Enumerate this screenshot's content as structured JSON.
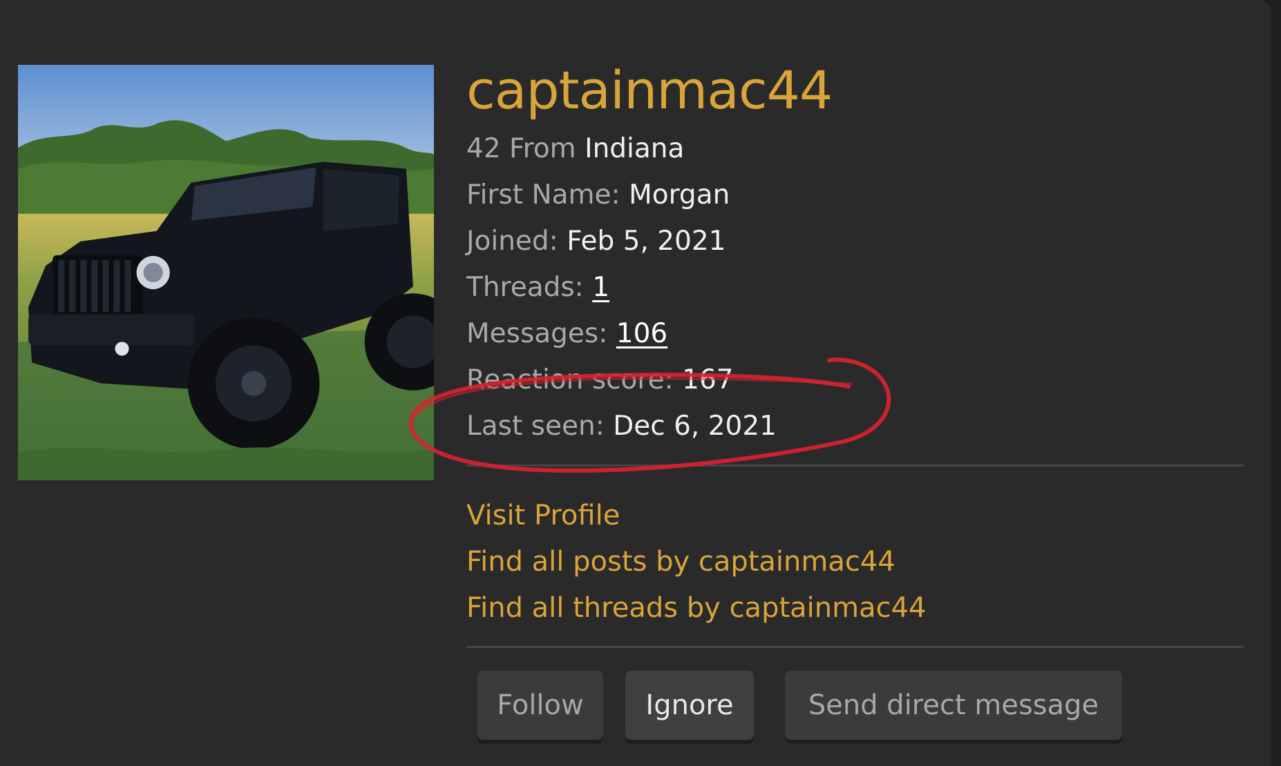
{
  "profile": {
    "username": "captainmac44",
    "age": "42",
    "from_label": "From",
    "location": "Indiana",
    "first_name_label": "First Name:",
    "first_name": "Morgan",
    "joined_label": "Joined:",
    "joined": "Feb 5, 2021",
    "threads_label": "Threads:",
    "threads": "1",
    "messages_label": "Messages:",
    "messages": "106",
    "reaction_label": "Reaction score:",
    "reaction": "167",
    "last_seen_label": "Last seen:",
    "last_seen": "Dec 6, 2021"
  },
  "links": {
    "visit_profile": "Visit Profile",
    "find_posts": "Find all posts by captainmac44",
    "find_threads": "Find all threads by captainmac44"
  },
  "buttons": {
    "follow": "Follow",
    "ignore": "Ignore",
    "send_dm": "Send direct message"
  },
  "colors": {
    "accent": "#d9a43a",
    "background": "#2a2a2a",
    "annotation": "#d8232f"
  },
  "icons": {
    "avatar": "jeep-photo"
  }
}
